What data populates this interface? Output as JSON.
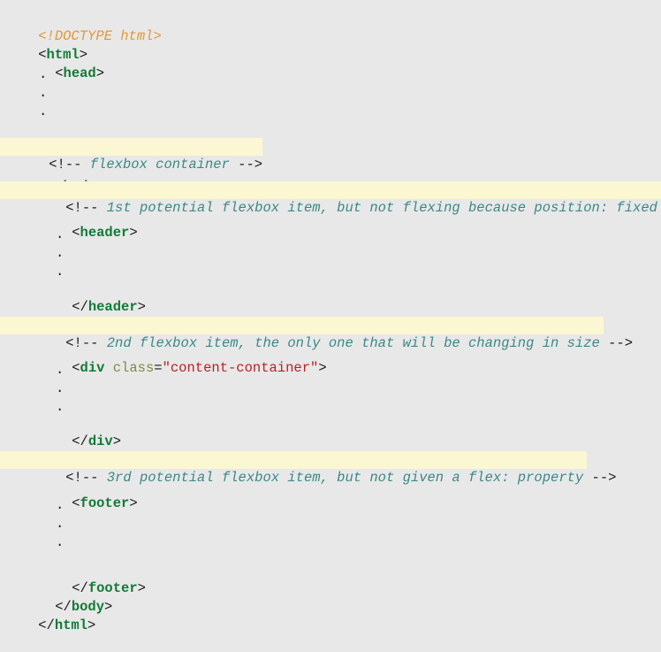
{
  "code": {
    "doctype": "<!DOCTYPE html>",
    "html_tag": "html",
    "head_tag": "head",
    "body_tag": "body",
    "header_tag": "header",
    "div_tag": "div",
    "footer_tag": "footer",
    "dot": ".",
    "comment_open": "<!-- ",
    "comment_close": " -->",
    "comments": {
      "flexbox_container": "flexbox container",
      "item1": "1st potential flexbox item, but not flexing because position: fixed",
      "item2": "2nd flexbox item, the only one that will be changing in size",
      "item3": "3rd potential flexbox item, but not given a flex: property"
    },
    "div_attr_name": "class",
    "div_attr_value": "\"content-container\"",
    "equals": "="
  },
  "colors": {
    "background": "#e8e8e8",
    "comment_highlight": "#fbf7d3",
    "tag": "#137a37",
    "doctype": "#e09a3a",
    "comment_text": "#3a8a86",
    "attribute": "#7d8d3a",
    "string": "#ba2121"
  }
}
